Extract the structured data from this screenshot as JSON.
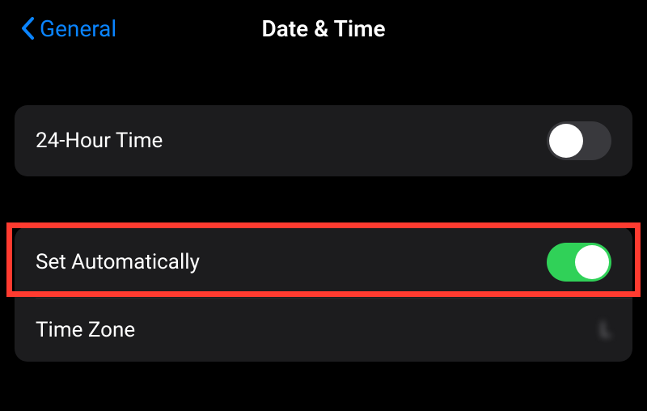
{
  "header": {
    "back_label": "General",
    "title": "Date & Time"
  },
  "rows": {
    "hour24_label": "24-Hour Time",
    "set_auto_label": "Set Automatically",
    "time_zone_label": "Time Zone",
    "time_zone_value": "L"
  },
  "toggles": {
    "hour24_on": false,
    "set_auto_on": true
  },
  "colors": {
    "accent": "#0a84ff",
    "toggle_on": "#30d158",
    "highlight": "#ff3b30"
  }
}
